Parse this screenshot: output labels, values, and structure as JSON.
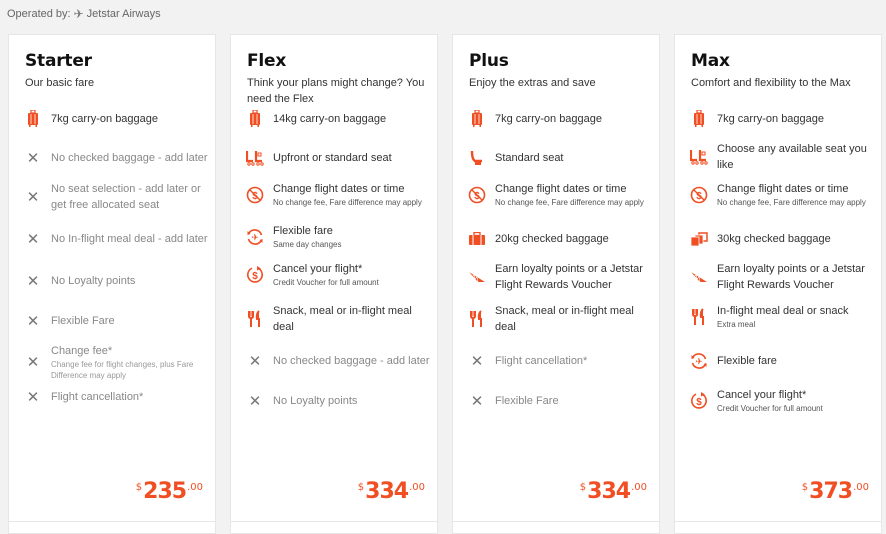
{
  "header": {
    "operated_by_label": "Operated by:",
    "airline": "Jetstar Airways",
    "airline_icon": "plane-icon"
  },
  "accent_color": "#f04e23",
  "fares": [
    {
      "name": "Starter",
      "subtitle": "Our basic fare",
      "price": {
        "currency": "$",
        "amount": "235",
        "cents": ".00"
      },
      "features": [
        {
          "icon": "carry-on-baggage-icon",
          "included": true,
          "main": "7kg carry-on baggage",
          "sub": ""
        },
        {
          "icon": "x-icon",
          "included": false,
          "main": "No checked baggage - add later",
          "sub": ""
        },
        {
          "icon": "x-icon",
          "included": false,
          "main": "No seat selection - add later or get free allocated seat",
          "sub": ""
        },
        {
          "icon": "x-icon",
          "included": false,
          "main": "No In-flight meal deal - add later",
          "sub": ""
        },
        {
          "icon": "x-icon",
          "included": false,
          "main": "No Loyalty points",
          "sub": ""
        },
        {
          "icon": "x-icon",
          "included": false,
          "main": "Flexible Fare",
          "sub": ""
        },
        {
          "icon": "x-icon",
          "included": false,
          "main": "Change fee*",
          "sub": "Change fee for flight changes, plus Fare Difference may apply"
        },
        {
          "icon": "x-icon",
          "included": false,
          "main": "Flight cancellation*",
          "sub": ""
        }
      ]
    },
    {
      "name": "Flex",
      "subtitle": "Think your plans might change? You need the Flex",
      "price": {
        "currency": "$",
        "amount": "334",
        "cents": ".00"
      },
      "features": [
        {
          "icon": "carry-on-baggage-icon",
          "included": true,
          "main": "14kg carry-on baggage",
          "sub": ""
        },
        {
          "icon": "upfront-seat-icon",
          "included": true,
          "main": "Upfront or standard seat",
          "sub": ""
        },
        {
          "icon": "no-change-fee-icon",
          "included": true,
          "main": "Change flight dates or time",
          "sub": "No change fee, Fare difference may apply"
        },
        {
          "icon": "flexible-fare-icon",
          "included": true,
          "main": "Flexible fare",
          "sub": "Same day changes"
        },
        {
          "icon": "cancel-refund-icon",
          "included": true,
          "main": "Cancel your flight*",
          "sub": "Credit Voucher for full amount"
        },
        {
          "icon": "meal-icon",
          "included": true,
          "main": "Snack, meal or in-flight meal deal",
          "sub": ""
        },
        {
          "icon": "x-icon",
          "included": false,
          "main": "No checked baggage - add later",
          "sub": ""
        },
        {
          "icon": "x-icon",
          "included": false,
          "main": "No Loyalty points",
          "sub": ""
        }
      ]
    },
    {
      "name": "Plus",
      "subtitle": "Enjoy the extras and save",
      "price": {
        "currency": "$",
        "amount": "334",
        "cents": ".00"
      },
      "features": [
        {
          "icon": "carry-on-baggage-icon",
          "included": true,
          "main": "7kg carry-on baggage",
          "sub": ""
        },
        {
          "icon": "standard-seat-icon",
          "included": true,
          "main": "Standard seat",
          "sub": ""
        },
        {
          "icon": "no-change-fee-icon",
          "included": true,
          "main": "Change flight dates or time",
          "sub": "No change fee, Fare difference may apply"
        },
        {
          "icon": "checked-baggage-icon",
          "included": true,
          "main": "20kg checked baggage",
          "sub": ""
        },
        {
          "icon": "loyalty-wing-icon",
          "included": true,
          "main": "Earn loyalty points or a Jetstar Flight Rewards Voucher",
          "sub": ""
        },
        {
          "icon": "meal-icon",
          "included": true,
          "main": "Snack, meal or in-flight meal deal",
          "sub": ""
        },
        {
          "icon": "x-icon",
          "included": false,
          "main": "Flight cancellation*",
          "sub": ""
        },
        {
          "icon": "x-icon",
          "included": false,
          "main": "Flexible Fare",
          "sub": ""
        }
      ]
    },
    {
      "name": "Max",
      "subtitle": "Comfort and flexibility to the Max",
      "price": {
        "currency": "$",
        "amount": "373",
        "cents": ".00"
      },
      "features": [
        {
          "icon": "carry-on-baggage-icon",
          "included": true,
          "main": "7kg carry-on baggage",
          "sub": ""
        },
        {
          "icon": "upfront-seat-icon",
          "included": true,
          "main": "Choose any available seat you like",
          "sub": ""
        },
        {
          "icon": "no-change-fee-icon",
          "included": true,
          "main": "Change flight dates or time",
          "sub": "No change fee, Fare difference may apply"
        },
        {
          "icon": "checked-baggage-multi-icon",
          "included": true,
          "main": "30kg checked baggage",
          "sub": ""
        },
        {
          "icon": "loyalty-wing-icon",
          "included": true,
          "main": "Earn loyalty points or a Jetstar Flight Rewards Voucher",
          "sub": ""
        },
        {
          "icon": "meal-icon",
          "included": true,
          "main": "In-flight meal deal or snack",
          "sub": "Extra meal"
        },
        {
          "icon": "flexible-fare-icon",
          "included": true,
          "main": "Flexible fare",
          "sub": ""
        },
        {
          "icon": "cancel-refund-icon",
          "included": true,
          "main": "Cancel your flight*",
          "sub": "Credit Voucher for full amount"
        }
      ]
    }
  ]
}
